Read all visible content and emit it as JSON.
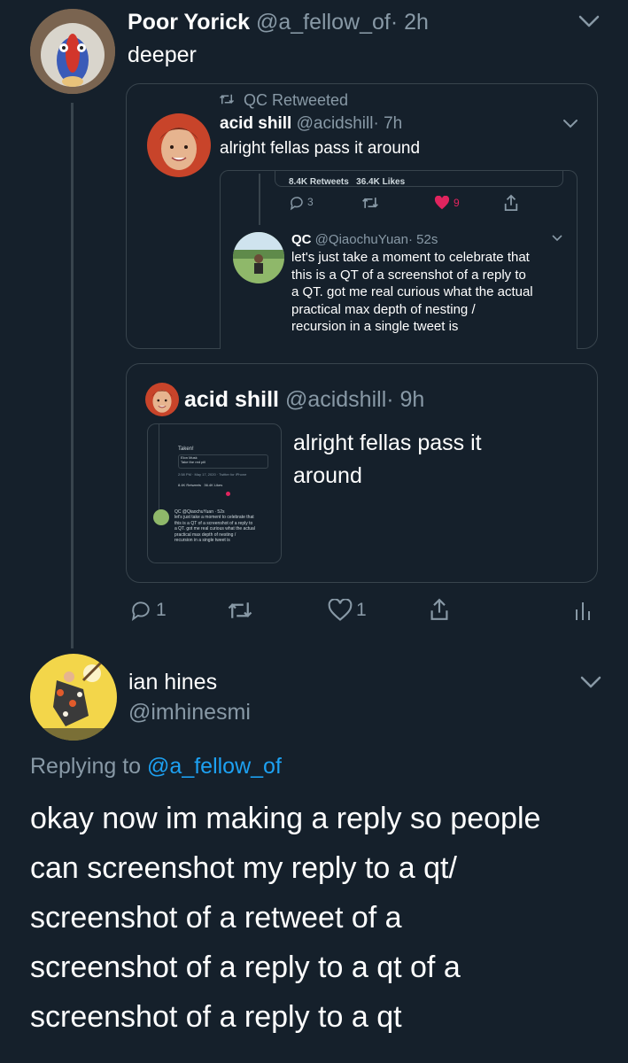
{
  "tweet1": {
    "name": "Poor Yorick",
    "handle": "@a_fellow_of",
    "time": "· 2h",
    "text": "deeper",
    "actions": {
      "replies": "1",
      "likes": "1"
    }
  },
  "embed1": {
    "retweeted_by": "QC Retweeted",
    "name": "acid shill",
    "handle": "@acidshill",
    "time": "· 7h",
    "text": "alright fellas pass it around",
    "screenshot": {
      "stats_top": "8.4K Retweets   36.4K Likes",
      "reply_count": "3",
      "like_count": "9",
      "inner": {
        "name": "QC",
        "handle": "@QiaochuYuan",
        "time": "· 52s",
        "text_lines": [
          "let's just take a moment to celebrate that",
          "this is a QT of a screenshot of a reply to",
          "a QT. got me real curious what the actual",
          "practical max depth of nesting /",
          "recursion in a single tweet is"
        ]
      }
    }
  },
  "embed2": {
    "name": "acid shill",
    "handle": "@acidshill",
    "time": "· 9h",
    "text_lines": [
      "alright fellas pass it",
      "around"
    ],
    "thumb": {
      "taken": "Taken!",
      "elon": "Elon Musk",
      "elon_text": "Take the red pill",
      "meta": "2:58 PM · May 17, 2020 · Twitter for iPhone",
      "stats": "8.4K Retweets   36.4K Likes",
      "qc": "QC @QiaochuYuan · 52s",
      "qc_lines": [
        "let's just take a moment to celebrate that",
        "this is a QT of a screenshot of a reply to",
        "a QT. got me real curious what the actual",
        "practical max depth of nesting /",
        "recursion in a single tweet is"
      ]
    }
  },
  "tweet2": {
    "name": "ian hines",
    "handle": "@imhinesmi",
    "replying_prefix": "Replying to ",
    "replying_handle": "@a_fellow_of",
    "text_lines": [
      "okay now im making a reply so people",
      "can screenshot my reply to a qt/",
      "screenshot of a retweet of a",
      "screenshot of a reply to a qt of a",
      "screenshot of a reply to a qt"
    ]
  },
  "colors": {
    "background": "#15202b",
    "border": "#38444d",
    "muted": "#8899a6",
    "link": "#1da1f2",
    "like": "#e0245e"
  },
  "icons": [
    "chevron-down-icon",
    "retweet-icon",
    "reply-icon",
    "like-icon",
    "share-icon",
    "analytics-icon"
  ]
}
